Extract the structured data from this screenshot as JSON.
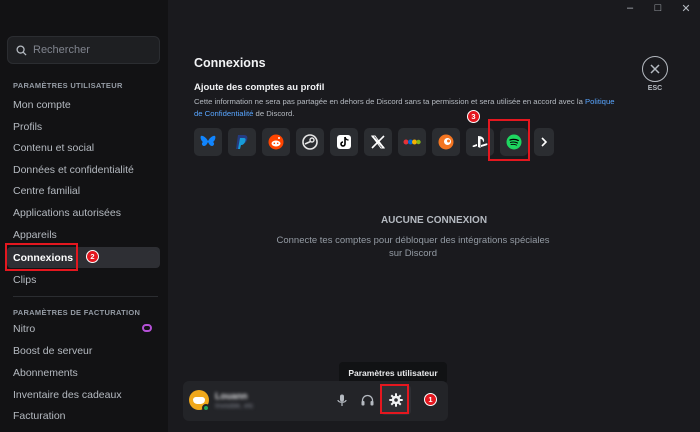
{
  "window": {
    "minimize": "–",
    "maximize": "□",
    "close": "✕"
  },
  "search": {
    "placeholder": "Rechercher"
  },
  "sidebar": {
    "user_settings_title": "PARAMÈTRES UTILISATEUR",
    "user_items": [
      "Mon compte",
      "Profils",
      "Contenu et social",
      "Données et confidentialité",
      "Centre familial",
      "Applications autorisées",
      "Appareils",
      "Connexions",
      "Clips"
    ],
    "active_item": "Connexions",
    "billing_title": "PARAMÈTRES DE FACTURATION",
    "billing_items": [
      "Nitro",
      "Boost de serveur",
      "Abonnements",
      "Inventaire des cadeaux",
      "Facturation"
    ]
  },
  "main": {
    "title": "Connexions",
    "subtitle": "Ajoute des comptes au profil",
    "description": "Cette information ne sera pas partagée en dehors de Discord sans ta permission et sera utilisée en accord avec la",
    "policy_link": "Politique de Confidentialité",
    "description_end": "de Discord.",
    "services": [
      "bluesky-icon",
      "paypal-icon",
      "reddit-icon",
      "steam-icon",
      "tiktok-icon",
      "x-icon",
      "ebay-icon",
      "crunchyroll-icon",
      "playstation-icon",
      "spotify-icon"
    ],
    "empty_title": "AUCUNE CONNEXION",
    "empty_description": "Connecte tes comptes pour débloquer des intégrations spéciales sur Discord",
    "esc_label": "ESC"
  },
  "user_panel": {
    "username": "Louann",
    "status": "Invisible, etc",
    "tooltip": "Paramètres utilisateur"
  },
  "annotations": {
    "gear": "1",
    "connexions": "2",
    "spotify": "3"
  },
  "colors": {
    "annotation": "#e4171f",
    "link": "#58a5ff",
    "spotify": "#1ed760",
    "nitro": "#b450d6"
  }
}
